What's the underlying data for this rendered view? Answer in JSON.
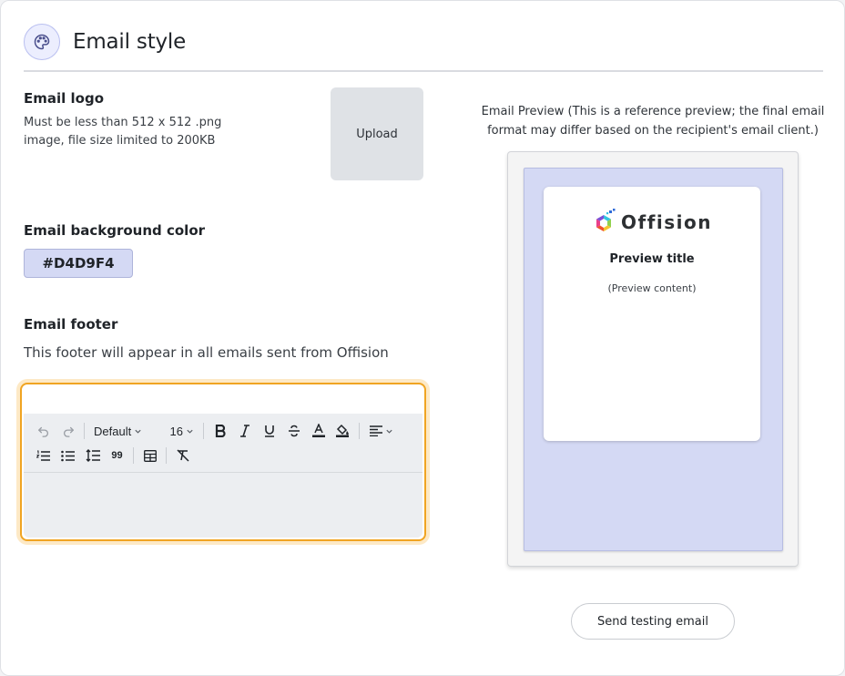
{
  "header": {
    "title": "Email style",
    "icon": "palette-icon"
  },
  "logo_section": {
    "label": "Email logo",
    "desc_line1": "Must be less than 512 x 512 .png",
    "desc_line2": "image, file size limited to 200KB",
    "upload_label": "Upload"
  },
  "background_section": {
    "label": "Email background color",
    "color_value": "#D4D9F4"
  },
  "footer_section": {
    "label": "Email footer",
    "description": "This footer will appear in all emails sent from Offision"
  },
  "editor": {
    "font_family": "Default",
    "font_size": "16",
    "quote_glyph": "99"
  },
  "preview": {
    "caption_line1": "Email Preview (This is a reference preview; the final email",
    "caption_line2": "format may differ based on the recipient's email client.)",
    "logo_text": "Offision",
    "title": "Preview title",
    "content": "(Preview content)"
  },
  "send_button": "Send testing email",
  "colors": {
    "accent": "#F0A422",
    "preview_background": "#D4D9F4"
  }
}
